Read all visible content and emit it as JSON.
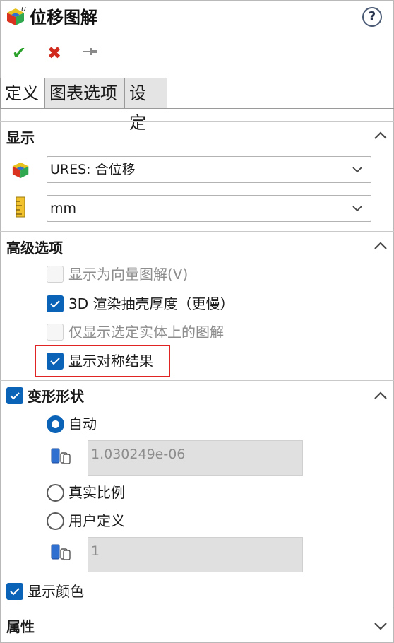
{
  "title": {
    "text": "位移图解",
    "icon": "displacement-plot-icon",
    "help": "?"
  },
  "actions": {
    "ok": "✔",
    "cancel": "✖",
    "pin": "⊸"
  },
  "tabs": [
    {
      "label": "定义",
      "active": true
    },
    {
      "label": "图表选项",
      "active": false
    },
    {
      "label": "设定",
      "active": false
    }
  ],
  "display": {
    "title": "显示",
    "component_value": "URES: 合位移",
    "unit_value": "mm"
  },
  "advanced": {
    "title": "高级选项",
    "options": [
      {
        "label": "显示为向量图解(V)",
        "checked": false,
        "enabled": false
      },
      {
        "label": "3D 渲染抽壳厚度（更慢）",
        "checked": true,
        "enabled": true
      },
      {
        "label": "仅显示选定实体上的图解",
        "checked": false,
        "enabled": false
      },
      {
        "label": "显示对称结果",
        "checked": true,
        "enabled": true,
        "highlighted": true
      }
    ]
  },
  "deformed": {
    "title": "变形形状",
    "checked": true,
    "auto_label": "自动",
    "auto_value": "1.030249e-06",
    "true_scale_label": "真实比例",
    "user_defined_label": "用户定义",
    "user_value": "1",
    "selected": "auto"
  },
  "show_color": {
    "label": "显示颜色",
    "checked": true
  },
  "properties": {
    "title": "属性"
  },
  "colors": {
    "accent": "#0b63b8",
    "highlight": "#e02424"
  }
}
